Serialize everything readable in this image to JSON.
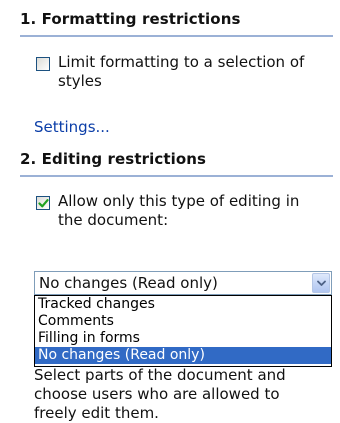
{
  "formatting_restrictions": {
    "title": "1. Formatting restrictions",
    "limit_checkbox": {
      "label_line1": "Limit formatting to a selection of",
      "label_line2": "styles",
      "checked": false
    },
    "settings_link": "Settings..."
  },
  "editing_restrictions": {
    "title": "2. Editing restrictions",
    "allow_checkbox": {
      "label_line1": "Allow only this type of editing in",
      "label_line2": "the document:",
      "checked": true
    },
    "combo": {
      "selected_value": "No changes (Read only)",
      "icon": "chevron-down-icon"
    },
    "options": [
      {
        "label": "Tracked changes",
        "selected": false
      },
      {
        "label": "Comments",
        "selected": false
      },
      {
        "label": "Filling in forms",
        "selected": false
      },
      {
        "label": "No changes (Read only)",
        "selected": true
      }
    ],
    "description": {
      "line1": "Select parts of the document and",
      "line2": "choose users who are allowed to",
      "line3": "freely edit them."
    }
  },
  "colors": {
    "section_rule": "#9bb1d6",
    "link": "#0b3ea8",
    "selection": "#316ac5",
    "check_mark": "#21a121"
  }
}
